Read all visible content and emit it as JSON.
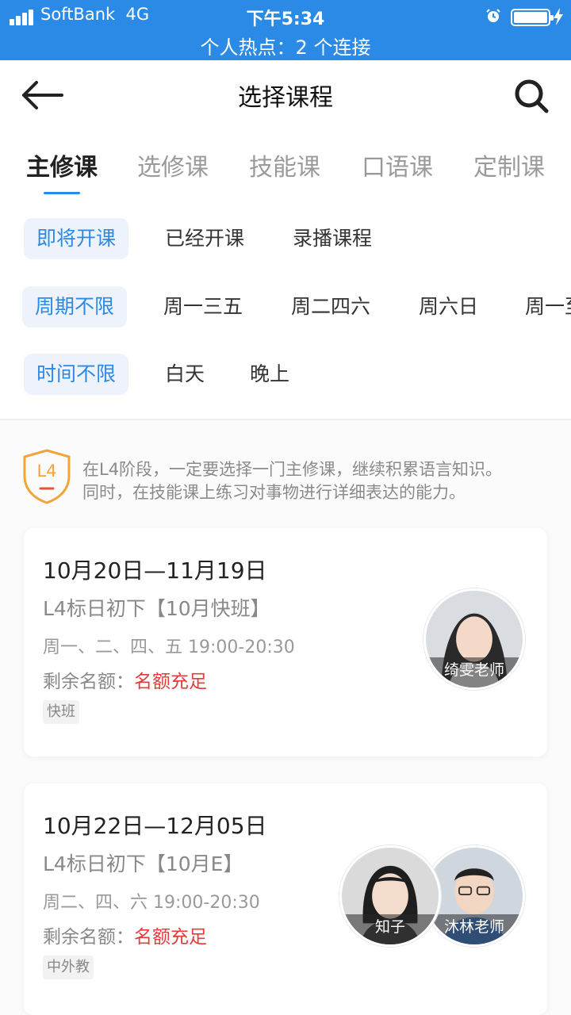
{
  "status_bar": {
    "carrier": "SoftBank",
    "network": "4G",
    "time": "下午5:34",
    "hotspot": "个人热点：2 个连接",
    "background_color": "#2a8ae6"
  },
  "nav": {
    "title": "选择课程",
    "back_icon": "arrow-left-icon",
    "search_icon": "search-icon"
  },
  "tabs": [
    {
      "label": "主修课",
      "active": true
    },
    {
      "label": "选修课",
      "active": false
    },
    {
      "label": "技能课",
      "active": false
    },
    {
      "label": "口语课",
      "active": false
    },
    {
      "label": "定制课",
      "active": false
    }
  ],
  "filters": {
    "status": [
      "即将开课",
      "已经开课",
      "录播课程"
    ],
    "weekdays": [
      "周期不限",
      "周一三五",
      "周二四六",
      "周六日",
      "周一至"
    ],
    "time": [
      "时间不限",
      "白天",
      "晚上"
    ]
  },
  "level_note": {
    "badge": "L4",
    "line1": "在L4阶段，一定要选择一门主修课，继续积累语言知识。",
    "line2": "同时，在技能课上练习对事物进行详细表达的能力。"
  },
  "courses": [
    {
      "date_range": "10月20日—11月19日",
      "name": "L4标日初下【10月快班】",
      "schedule": "周一、二、四、五 19:00-20:30",
      "quota_label": "剩余名额：",
      "quota_value": "名额充足",
      "tag": "快班",
      "teachers": [
        "绮雯老师"
      ]
    },
    {
      "date_range": "10月22日—12月05日",
      "name": "L4标日初下【10月E】",
      "schedule": "周二、四、六 19:00-20:30",
      "quota_label": "剩余名额：",
      "quota_value": "名额充足",
      "tag": "中外教",
      "teachers": [
        "知子",
        "沐林老师"
      ]
    }
  ],
  "colors": {
    "accent": "#2a8ae6",
    "quota_full": "#e33b3b",
    "badge_orange": "#f2a33a"
  }
}
